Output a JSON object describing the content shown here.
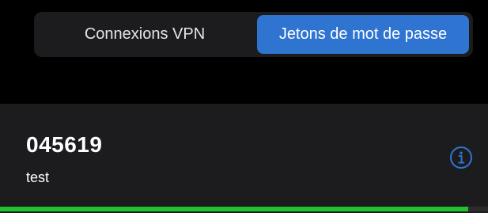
{
  "tabs": [
    {
      "label": "Connexions VPN",
      "selected": false
    },
    {
      "label": "Jetons de mot de passe",
      "selected": true
    }
  ],
  "token": {
    "code": "045619",
    "name": "test",
    "info_icon": "info-circle-icon",
    "progress": 0.96
  },
  "colors": {
    "background": "#000000",
    "card": "#1c1c1e",
    "accent": "#2f74d0",
    "progress": "#22c32e"
  }
}
